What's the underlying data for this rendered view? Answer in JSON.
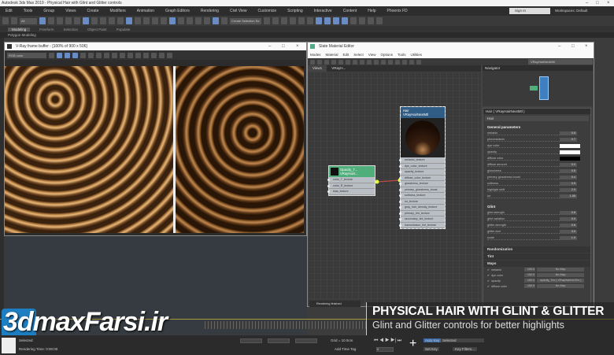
{
  "app": {
    "title": "Autodesk 3ds Max 2019 - Physical Hair with Glint and Glitter controls"
  },
  "menu": [
    "Edit",
    "Tools",
    "Group",
    "Views",
    "Create",
    "Modifiers",
    "Animation",
    "Graph Editors",
    "Rendering",
    "Civil View",
    "Customize",
    "Scripting",
    "Interactive",
    "Content",
    "Help",
    "Phoenix FD"
  ],
  "signin": "Sign In",
  "workspace": "Workspaces: Default",
  "toolbar": {
    "selection_filter": "All",
    "named_selection": "Create Selection Se"
  },
  "ribbon": {
    "tabs": [
      "Modeling",
      "Freeform",
      "Selection",
      "Object Paint",
      "Populate"
    ],
    "active": "Modeling",
    "panel": "Polygon Modeling"
  },
  "vfb": {
    "title": "V-Ray frame buffer - [100% of 900 x 506]",
    "channel": "RGB color"
  },
  "sme": {
    "title": "Slate Material Editor",
    "menu": [
      "Modes",
      "Material",
      "Edit",
      "Select",
      "View",
      "Options",
      "Tools",
      "Utilities"
    ],
    "material_dropdown": "VRayHairNextMtl",
    "tabs": [
      "View1",
      "VRayH..."
    ],
    "node_opacity": {
      "title": "Opacity_T...",
      "subtitle": "VRayHairI...",
      "slots": [
        "color_T_texture",
        "color_R_texture",
        "bias_texture"
      ]
    },
    "node_hair": {
      "title": "Hair",
      "subtitle": "VRayHairNextMtl",
      "slots": [
        "melanin_texture",
        "dye_color_texture",
        "opacity_texture",
        "diffuse_color_texture",
        "glossiness_texture",
        "primary_glossiness_boost",
        "softness_texture",
        "ior_texture",
        "gray_hair_density_texture",
        "primary_tint_texture",
        "secondary_tint_texture",
        "transmission_tint_texture"
      ]
    },
    "navigator": "Navigator",
    "params_header": "Hair  ( VRayHairNextMtl )",
    "params_name": "Hair",
    "general": {
      "title": "General parameters",
      "rows": [
        {
          "label": "melanin",
          "value": "0.5"
        },
        {
          "label": "pheomelanin",
          "value": "0.7"
        },
        {
          "label": "dye color",
          "swatch": "#ffffff"
        },
        {
          "label": "opacity",
          "swatch": "#ffffff"
        },
        {
          "label": "diffuse color",
          "swatch": "#000000"
        },
        {
          "label": "diffuse amount",
          "value": "0.0"
        },
        {
          "label": "glossiness",
          "value": "0.5"
        },
        {
          "label": "primary glossiness boost",
          "value": "0.4"
        },
        {
          "label": "softness",
          "value": "0.5"
        },
        {
          "label": "highlight shift",
          "value": "2.0"
        },
        {
          "label": "ior",
          "value": "1.55"
        }
      ]
    },
    "glint": {
      "title": "Glint",
      "rows": [
        {
          "label": "glint strength",
          "value": "0.8"
        },
        {
          "label": "glint variation",
          "value": "0.0"
        },
        {
          "label": "glitter strength",
          "value": "0.6"
        },
        {
          "label": "glitter size",
          "value": "3.0"
        },
        {
          "label": "scale",
          "value": "1.0"
        }
      ]
    },
    "sections": [
      "Randomization",
      "Tint"
    ],
    "maps": {
      "title": "Maps",
      "rows": [
        {
          "label": "melanin",
          "amt": "100.0",
          "map": "No Map"
        },
        {
          "label": "dye color",
          "amt": "100.0",
          "map": "No Map"
        },
        {
          "label": "opacity",
          "amt": "100.0",
          "map": "opacity_Tex ( VRayHairInfoTex )"
        },
        {
          "label": "diffuse color",
          "amt": "100.0",
          "map": "No Map"
        }
      ]
    },
    "rendering_finished": "Rendering finished"
  },
  "overlay": {
    "title": "PHYSICAL HAIR WITH GLINT & GLITTER",
    "subtitle": "Glint and Glitter controls for better highlights"
  },
  "logo": "3dmaxFarsi.ir",
  "status": {
    "selected": "Selected",
    "render_time": "Rendering Time: 0:00:00",
    "grid": "Grid = 10.0cm",
    "add_time_tag": "Add Time Tag",
    "auto_key": "Auto Key",
    "set_key": "Set Key",
    "key_mode": "Selected",
    "key_filters": "Key Filters...",
    "frame": "0"
  },
  "colors": {
    "accent": "#6a8cc4",
    "node_hair_header": "#2f5d86",
    "node_opacity_header": "#4fae7a",
    "logo": "#1d7ec2"
  }
}
